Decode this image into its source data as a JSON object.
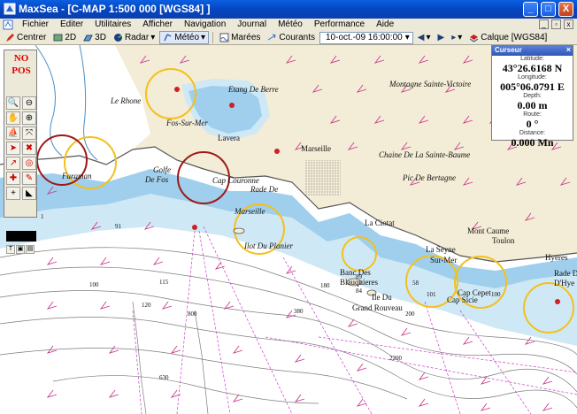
{
  "window": {
    "title": "MaxSea - [C-MAP  1:500 000 [WGS84] ]",
    "min": "_",
    "max": "□",
    "close": "X"
  },
  "menu": {
    "items": [
      "Fichier",
      "Editer",
      "Utilitaires",
      "Afficher",
      "Navigation",
      "Journal",
      "Météo",
      "Performance",
      "Aide"
    ]
  },
  "toolbar": {
    "centre": "Centrer",
    "view2d": "2D",
    "view3d": "3D",
    "radar": "Radar",
    "meteo": "Météo",
    "marees": "Marées",
    "courants": "Courants",
    "datetime": "10-oct.-09 16:00:00",
    "calque": "Calque [WGS84]"
  },
  "palette": {
    "status_line1": "NO",
    "status_line2": "POS"
  },
  "cursor": {
    "title": "Curseur",
    "latitude_label": "Latitude:",
    "latitude": "43°26.6168 N",
    "longitude_label": "Longitude:",
    "longitude": "005°06.0791 E",
    "depth_label": "Depth:",
    "depth": "0.00 m",
    "route_label": "Route:",
    "route": "0 °",
    "distance_label": "Distance:",
    "distance": "0.000 Mn"
  },
  "map": {
    "places": {
      "rhone": "Le Rhone",
      "fos": "Fos-Sur-Mer",
      "berre": "Etang De Berre",
      "victoire": "Montagne Sainte-Victoire",
      "lavera": "Lavera",
      "marseille_city": "Marseille",
      "golfe": "Golfe",
      "defos": "De Fos",
      "faraman": "Faraman",
      "couronne": "Cap Couronne",
      "rade": "Rade De",
      "marseille_rade": "Marseille",
      "baume": "Chaine De La Sainte-Baume",
      "bertagne": "Pic De Bertagne",
      "planier": "Ilot Du Planier",
      "ciotat": "La Ciotat",
      "caume": "Mont Caume",
      "toulon": "Toulon",
      "seyne": "La Seyne",
      "surmer": "Sur-Mer",
      "hyeres": "Hyeres",
      "bancs": "Banc Des",
      "blauquieres": "Blauquieres",
      "iledu": "Ile Du",
      "rouveau": "Grand Rouveau",
      "cepet": "Cap Cepet",
      "sicie": "Cap Sicie",
      "radede": "Rade De",
      "dhye": "D'Hye"
    },
    "soundings": [
      "1",
      "91",
      "100",
      "115",
      "120",
      "180",
      "800",
      "89",
      "84",
      "58",
      "101",
      "100",
      "630",
      "200",
      "380",
      "2200"
    ]
  }
}
